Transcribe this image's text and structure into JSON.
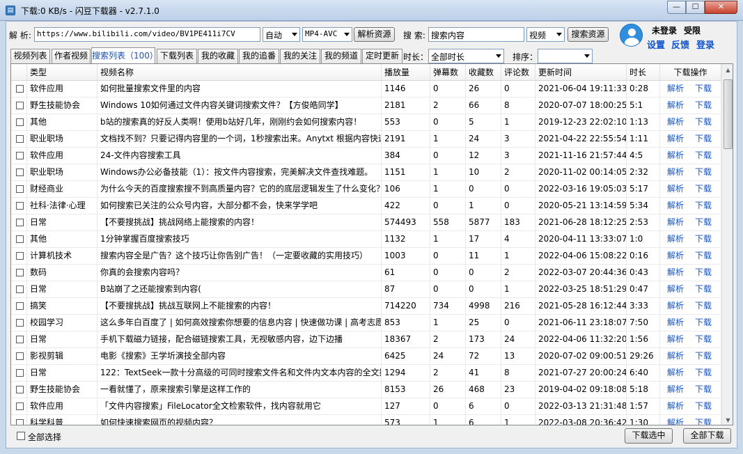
{
  "window": {
    "title": "下载:0 KB/s - 闪豆下载器 - v2.7.1.0",
    "minimize": "—",
    "maximize": "☐",
    "close": "✕"
  },
  "toolbar": {
    "url_label": "解 析:",
    "url_value": "https://www.bilibili.com/video/BV1PE411i7CV",
    "quality_value": "自动",
    "format_value": "MP4-AVC",
    "parse_button": "解析资源",
    "search_label": "搜 索:",
    "search_value": "搜索内容",
    "search_type_value": "视频",
    "search_button": "搜索资源"
  },
  "user": {
    "status": "未登录",
    "permission": "受限",
    "settings": "设置",
    "feedback": "反馈",
    "login": "登录"
  },
  "tabs": [
    {
      "label": "视频列表",
      "active": false
    },
    {
      "label": "作者视频",
      "active": false
    },
    {
      "label": "搜索列表（100）",
      "active": true
    },
    {
      "label": "下载列表",
      "active": false
    },
    {
      "label": "我的收藏",
      "active": false
    },
    {
      "label": "我的追番",
      "active": false
    },
    {
      "label": "我的关注",
      "active": false
    },
    {
      "label": "我的频道",
      "active": false
    },
    {
      "label": "定时更新",
      "active": false
    }
  ],
  "filters": {
    "duration_label": "时长：",
    "duration_value": "全部时长",
    "sort_label": "排序：",
    "sort_value": ""
  },
  "table": {
    "columns": [
      "类型",
      "视频名称",
      "播放量",
      "弹幕数",
      "收藏数",
      "评论数",
      "更新时间",
      "时长",
      "下载操作"
    ],
    "action_parse": "解析",
    "action_download": "下载",
    "rows": [
      [
        "软件应用",
        "如何批量搜索文件里的内容",
        "1146",
        "0",
        "26",
        "0",
        "2021-06-04 19:11:33",
        "0:28"
      ],
      [
        "野生技能协会",
        "Windows 10如何通过文件内容关键词搜索文件？【方俊皓同学】",
        "2181",
        "2",
        "66",
        "8",
        "2020-07-07 18:00:25",
        "5:1"
      ],
      [
        "其他",
        "b站的搜索真的好反人类啊！使用b站好几年，刚刚约会如何搜索内容！",
        "553",
        "0",
        "5",
        "1",
        "2019-12-23 22:02:10",
        "1:13"
      ],
      [
        "职业职场",
        "文档找不到？只要记得内容里的一个词，1秒搜索出来。Anytxt 根据内容快速",
        "2191",
        "1",
        "24",
        "3",
        "2021-04-22 22:55:54",
        "1:11"
      ],
      [
        "软件应用",
        "24-文件内容搜索工具",
        "384",
        "0",
        "12",
        "3",
        "2021-11-16 21:57:44",
        "4:5"
      ],
      [
        "职业职场",
        "Windows办公必备技能（1）：按文件内容搜索，完美解决文件查找难题。",
        "1151",
        "1",
        "10",
        "2",
        "2020-11-02 00:14:05",
        "2:32"
      ],
      [
        "财经商业",
        "为什么今天的百度搜索搜不到高质量内容？它的的底层逻辑发生了什么变化？",
        "106",
        "1",
        "0",
        "0",
        "2022-03-16 19:05:03",
        "5:17"
      ],
      [
        "社科·法律·心理",
        "如何搜索已关注的公众号内容，大部分都不会，快来学学吧",
        "422",
        "0",
        "1",
        "0",
        "2020-05-21 13:14:59",
        "5:34"
      ],
      [
        "日常",
        "【不要搜挑战】挑战网络上能搜索的内容！",
        "574493",
        "558",
        "5877",
        "183",
        "2021-06-28 18:12:25",
        "2:53"
      ],
      [
        "其他",
        "1分钟掌握百度搜索技巧",
        "1132",
        "1",
        "17",
        "4",
        "2020-04-11 13:33:07",
        "1:0"
      ],
      [
        "计算机技术",
        "搜索内容全是广告？这个技巧让你告别广告！（一定要收藏的实用技巧）",
        "1003",
        "0",
        "11",
        "1",
        "2022-04-06 15:08:22",
        "0:16"
      ],
      [
        "数码",
        "你真的会搜索内容吗？",
        "61",
        "0",
        "0",
        "2",
        "2022-03-07 20:44:36",
        "0:43"
      ],
      [
        "日常",
        "B站崩了之还能搜索到内容(",
        "87",
        "0",
        "0",
        "1",
        "2022-03-25 18:51:29",
        "0:47"
      ],
      [
        "搞笑",
        "【不要搜挑战】挑战互联网上不能搜索的内容！",
        "714220",
        "734",
        "4998",
        "216",
        "2021-05-28 16:12:44",
        "3:33"
      ],
      [
        "校园学习",
        "这么多年白百度了 | 如何高效搜索你想要的信息内容 | 快速做功课 | 高考志愿",
        "853",
        "1",
        "25",
        "0",
        "2021-06-11 23:18:07",
        "7:50"
      ],
      [
        "日常",
        "手机下载磁力链接，配合磁链搜索工具，无视敏感内容，边下边播",
        "18367",
        "2",
        "173",
        "24",
        "2022-04-06 11:32:20",
        "1:56"
      ],
      [
        "影视剪辑",
        "电影《搜索》王学圻演技全部内容",
        "6425",
        "24",
        "72",
        "13",
        "2020-07-02 09:00:51",
        "29:26"
      ],
      [
        "日常",
        "122：TextSeek一款十分高级的可同时搜索文件名和文件内文本内容的全文搜",
        "1294",
        "2",
        "41",
        "8",
        "2021-07-27 20:00:24",
        "6:40"
      ],
      [
        "野生技能协会",
        "一看就懂了，原来搜索引擎是这样工作的",
        "8153",
        "26",
        "468",
        "23",
        "2019-04-02 09:18:08",
        "5:18"
      ],
      [
        "软件应用",
        "「文件内容搜索」FileLocator全文检索软件，找内容就用它",
        "127",
        "0",
        "6",
        "0",
        "2022-03-13 21:31:48",
        "1:57"
      ],
      [
        "科学科普",
        "如何快速搜索网页的视频内容？",
        "573",
        "1",
        "6",
        "1",
        "2022-03-08 20:36:42",
        "1:30"
      ]
    ]
  },
  "footer": {
    "select_all": "全部选择",
    "download_selected": "下载选中",
    "download_all": "全部下载"
  }
}
